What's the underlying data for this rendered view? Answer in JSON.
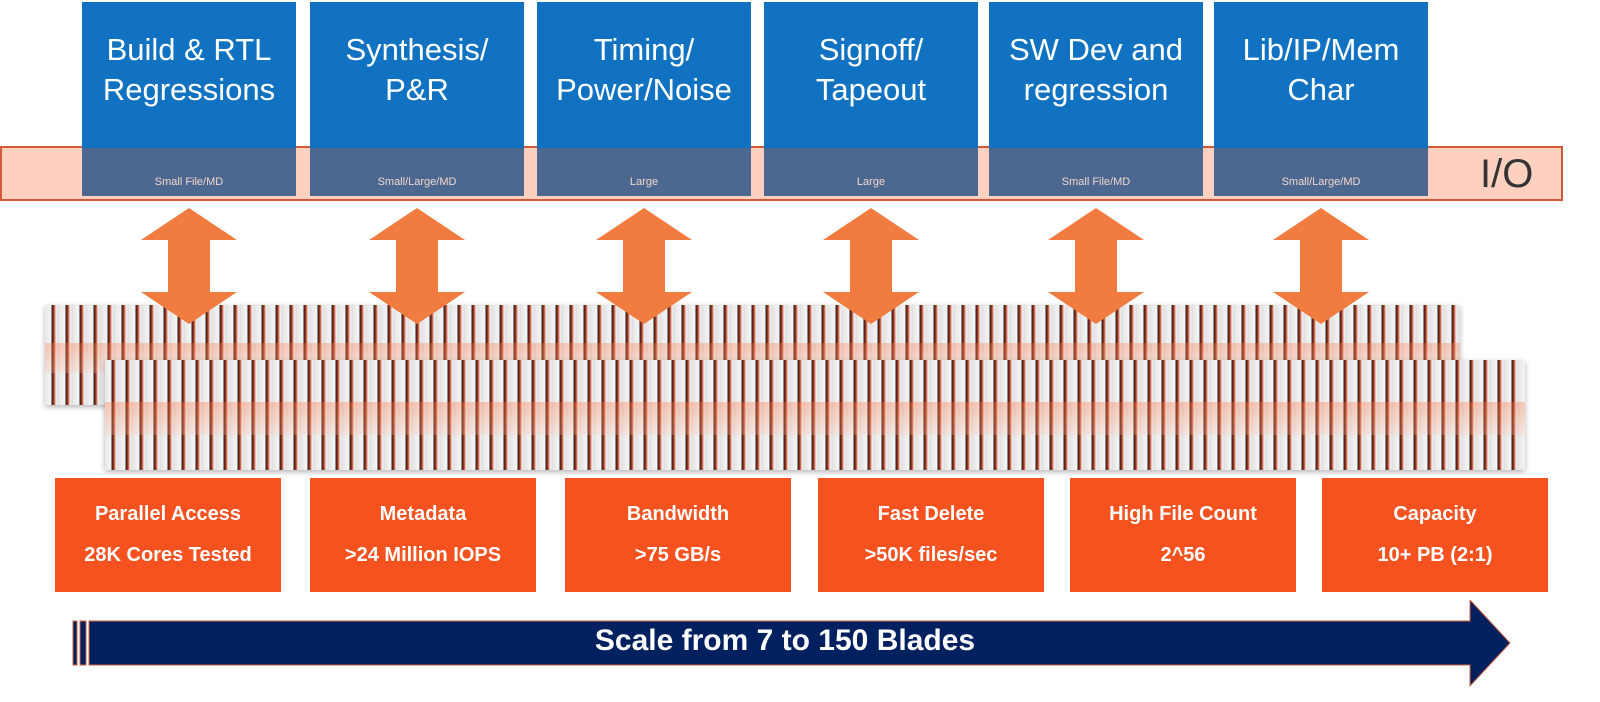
{
  "workloads": [
    {
      "title": "Build & RTL Regressions",
      "io": "Small File/MD"
    },
    {
      "title": "Synthesis/ P&R",
      "io": "Small/Large/MD"
    },
    {
      "title": "Timing/ Power/Noise",
      "io": "Large"
    },
    {
      "title": "Signoff/ Tapeout",
      "io": "Large"
    },
    {
      "title": "SW Dev and regression",
      "io": "Small File/MD"
    },
    {
      "title": "Lib/IP/Mem Char",
      "io": "Small/Large/MD"
    }
  ],
  "io_label": "I/O",
  "features": [
    {
      "name": "Parallel Access",
      "value": "28K Cores Tested"
    },
    {
      "name": "Metadata",
      "value": ">24 Million IOPS"
    },
    {
      "name": "Bandwidth",
      "value": ">75 GB/s"
    },
    {
      "name": "Fast Delete",
      "value": ">50K files/sec"
    },
    {
      "name": "High File Count",
      "value": "2^56"
    },
    {
      "name": "Capacity",
      "value": "10+ PB (2:1)"
    }
  ],
  "scale_label": "Scale from 7 to 150 Blades",
  "colors": {
    "blue": "#1072c0",
    "io_gray": "#4c6890",
    "orange_box": "#f55220",
    "arrow_orange": "#f07c40",
    "navy": "#002060",
    "io_band": "#fdd0c0"
  }
}
